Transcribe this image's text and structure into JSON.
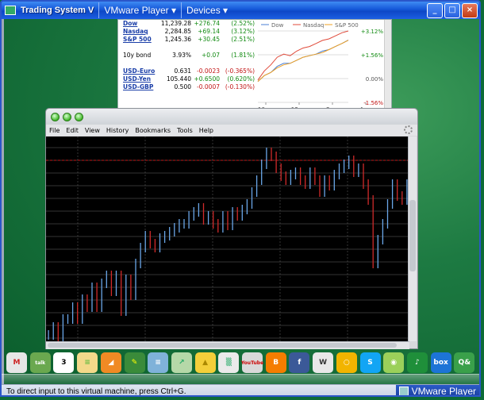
{
  "window": {
    "title": "Trading System V",
    "vm_menu": "VMware Player ▾",
    "devices_menu": "Devices ▾",
    "buttons": [
      "_",
      "□",
      "×"
    ]
  },
  "market": {
    "rows": [
      {
        "name": "Dow",
        "value": "11,239.28",
        "change": "+276.74",
        "pct": "(2.52%)",
        "dir": "up",
        "link": true
      },
      {
        "name": "Nasdaq",
        "value": "2,284.85",
        "change": "+69.14",
        "pct": "(3.12%)",
        "dir": "up",
        "link": true
      },
      {
        "name": "S&P 500",
        "value": "1,245.36",
        "change": "+30.45",
        "pct": "(2.51%)",
        "dir": "up",
        "link": true
      },
      {
        "name": "",
        "value": "",
        "change": "",
        "pct": "",
        "dir": "",
        "link": false
      },
      {
        "name": "10y bond",
        "value": "3.93%",
        "change": "+0.07",
        "pct": "(1.81%)",
        "dir": "up",
        "link": false
      },
      {
        "name": "",
        "value": "",
        "change": "",
        "pct": "",
        "dir": "",
        "link": false
      },
      {
        "name": "USD-Euro",
        "value": "0.631",
        "change": "-0.0023",
        "pct": "(-0.365%)",
        "dir": "down",
        "link": true
      },
      {
        "name": "USD-Yen",
        "value": "105.440",
        "change": "+0.6500",
        "pct": "(0.620%)",
        "dir": "up",
        "link": true
      },
      {
        "name": "USD-GBP",
        "value": "0.500",
        "change": "-0.0007",
        "pct": "(-0.130%)",
        "dir": "down",
        "link": true
      }
    ],
    "legend": [
      "Dow",
      "Nasdaq",
      "S&P 500"
    ],
    "y_labels": [
      "+3.12%",
      "+1.56%",
      "0.00%",
      "-1.56%"
    ],
    "x_labels": [
      "10am",
      "12pm",
      "2pm",
      "4pm"
    ],
    "colors": {
      "dow": "#4a7fd4",
      "nasdaq": "#e04a3a",
      "sp500": "#f0a020",
      "up": "#118a11",
      "down": "#c21515"
    }
  },
  "browser": {
    "menu": [
      "File",
      "Edit",
      "View",
      "History",
      "Bookmarks",
      "Tools",
      "Help"
    ]
  },
  "dock": {
    "icons": [
      {
        "name": "gmail-icon",
        "label": "M",
        "color": "#e6e6e6",
        "text": "#c22"
      },
      {
        "name": "talk-icon",
        "label": "talk",
        "color": "#6aa84f",
        "text": "#fff"
      },
      {
        "name": "calendar-icon",
        "label": "3",
        "color": "#ffffff",
        "text": "#000"
      },
      {
        "name": "notes-icon",
        "label": "≡",
        "color": "#f3d98a",
        "text": "#6b4"
      },
      {
        "name": "rss-icon",
        "label": "◢",
        "color": "#f08a24",
        "text": "#fff"
      },
      {
        "name": "pencil-icon",
        "label": "✎",
        "color": "#3a8b3a",
        "text": "#ff0"
      },
      {
        "name": "books-icon",
        "label": "≡",
        "color": "#7fb2d9",
        "text": "#fff"
      },
      {
        "name": "stocks-icon",
        "label": "↗",
        "color": "#b5d8a8",
        "text": "#2a6"
      },
      {
        "name": "shopping-bag-icon",
        "label": "▲",
        "color": "#f3cf3a",
        "text": "#a80"
      },
      {
        "name": "spreadsheet-icon",
        "label": "▒",
        "color": "#eaeaea",
        "text": "#2a6"
      },
      {
        "name": "youtube-icon",
        "label": "YouTube",
        "color": "#d9d9d9",
        "text": "#c00"
      },
      {
        "name": "blogger-icon",
        "label": "B",
        "color": "#f57d00",
        "text": "#fff"
      },
      {
        "name": "facebook-icon",
        "label": "f",
        "color": "#3b5998",
        "text": "#fff"
      },
      {
        "name": "wikipedia-icon",
        "label": "W",
        "color": "#e8e8e8",
        "text": "#333"
      },
      {
        "name": "orkut-icon",
        "label": "○",
        "color": "#f2b400",
        "text": "#fff"
      },
      {
        "name": "skype-icon",
        "label": "S",
        "color": "#12a5f4",
        "text": "#fff"
      },
      {
        "name": "music-disc-icon",
        "label": "◉",
        "color": "#9bd05a",
        "text": "#fff"
      },
      {
        "name": "music-note-icon",
        "label": "♪",
        "color": "#1f8f3a",
        "text": "#fff"
      },
      {
        "name": "box-icon",
        "label": "box",
        "color": "#1d74d6",
        "text": "#fff"
      },
      {
        "name": "qa-icon",
        "label": "Q&",
        "color": "#3aa04a",
        "text": "#fff"
      }
    ]
  },
  "status": {
    "text": "To direct input to this virtual machine, press Ctrl+G.",
    "logo": "VMware Player"
  },
  "chart_data": [
    {
      "type": "line",
      "title": "",
      "series": [
        {
          "name": "Dow",
          "values": [
            -0.2,
            0.2,
            0.4,
            0.8,
            1.0,
            1.0,
            1.2,
            1.4,
            1.5,
            1.6,
            1.8,
            1.9,
            2.1,
            2.3,
            2.52
          ]
        },
        {
          "name": "Nasdaq",
          "values": [
            -0.1,
            0.5,
            0.9,
            1.4,
            1.6,
            1.5,
            1.8,
            2.0,
            2.1,
            2.3,
            2.5,
            2.6,
            2.8,
            3.0,
            3.12
          ]
        },
        {
          "name": "S&P 500",
          "values": [
            -0.2,
            0.2,
            0.4,
            0.7,
            0.9,
            1.0,
            1.2,
            1.4,
            1.5,
            1.6,
            1.7,
            1.9,
            2.1,
            2.3,
            2.51
          ]
        }
      ],
      "ylim": [
        -1.56,
        3.12
      ],
      "xlabels": [
        "10am",
        "12pm",
        "2pm",
        "4pm"
      ]
    },
    {
      "type": "line",
      "title": "",
      "series": [
        {
          "name": "",
          "values": [
            250,
            240,
            255,
            230,
            230,
            215,
            230,
            205,
            215,
            190,
            215,
            185,
            175,
            195,
            175,
            220,
            180,
            200,
            160,
            140,
            125,
            135,
            140,
            128,
            125,
            120,
            115,
            110,
            110,
            100,
            95,
            90,
            105,
            100,
            110,
            115,
            100,
            112,
            95,
            100,
            92,
            85,
            70,
            55,
            35,
            20,
            25,
            40,
            50,
            55,
            48,
            45,
            55,
            60,
            45,
            55,
            70,
            55,
            62,
            48,
            40,
            35,
            30,
            45,
            40,
            60,
            80,
            160,
            130,
            110,
            85,
            60,
            75,
            80,
            60
          ]
        }
      ]
    }
  ]
}
